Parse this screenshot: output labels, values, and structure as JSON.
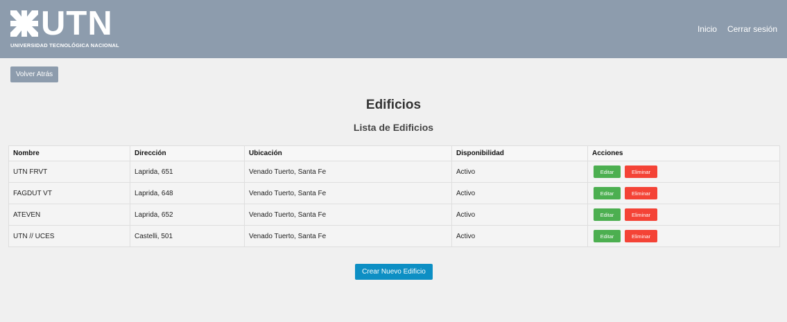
{
  "brand": {
    "name": "UTN",
    "subtitle": "UNIVERSIDAD TECNOLÓGICA NACIONAL",
    "color_header": "#8d9cad"
  },
  "nav": {
    "inicio": "Inicio",
    "logout": "Cerrar sesión"
  },
  "back_label": "Volver Atrás",
  "title": "Edificios",
  "subtitle": "Lista de Edificios",
  "table": {
    "headers": [
      "Nombre",
      "Dirección",
      "Ubicación",
      "Disponibilidad",
      "Acciones"
    ],
    "rows": [
      {
        "nombre": "UTN FRVT",
        "direccion": "Laprida, 651",
        "ubicacion": "Venado Tuerto, Santa Fe",
        "disponibilidad": "Activo"
      },
      {
        "nombre": "FAGDUT VT",
        "direccion": "Laprida, 648",
        "ubicacion": "Venado Tuerto, Santa Fe",
        "disponibilidad": "Activo"
      },
      {
        "nombre": "ATEVEN",
        "direccion": "Laprida, 652",
        "ubicacion": "Venado Tuerto, Santa Fe",
        "disponibilidad": "Activo"
      },
      {
        "nombre": "UTN // UCES",
        "direccion": "Castelli, 501",
        "ubicacion": "Venado Tuerto, Santa Fe",
        "disponibilidad": "Activo"
      }
    ],
    "edit_label": "Editar",
    "delete_label": "Eliminar"
  },
  "create_label": "Crear Nuevo Edificio",
  "colors": {
    "edit": "#4caf50",
    "delete": "#f44336",
    "create": "#0d8fc4"
  }
}
